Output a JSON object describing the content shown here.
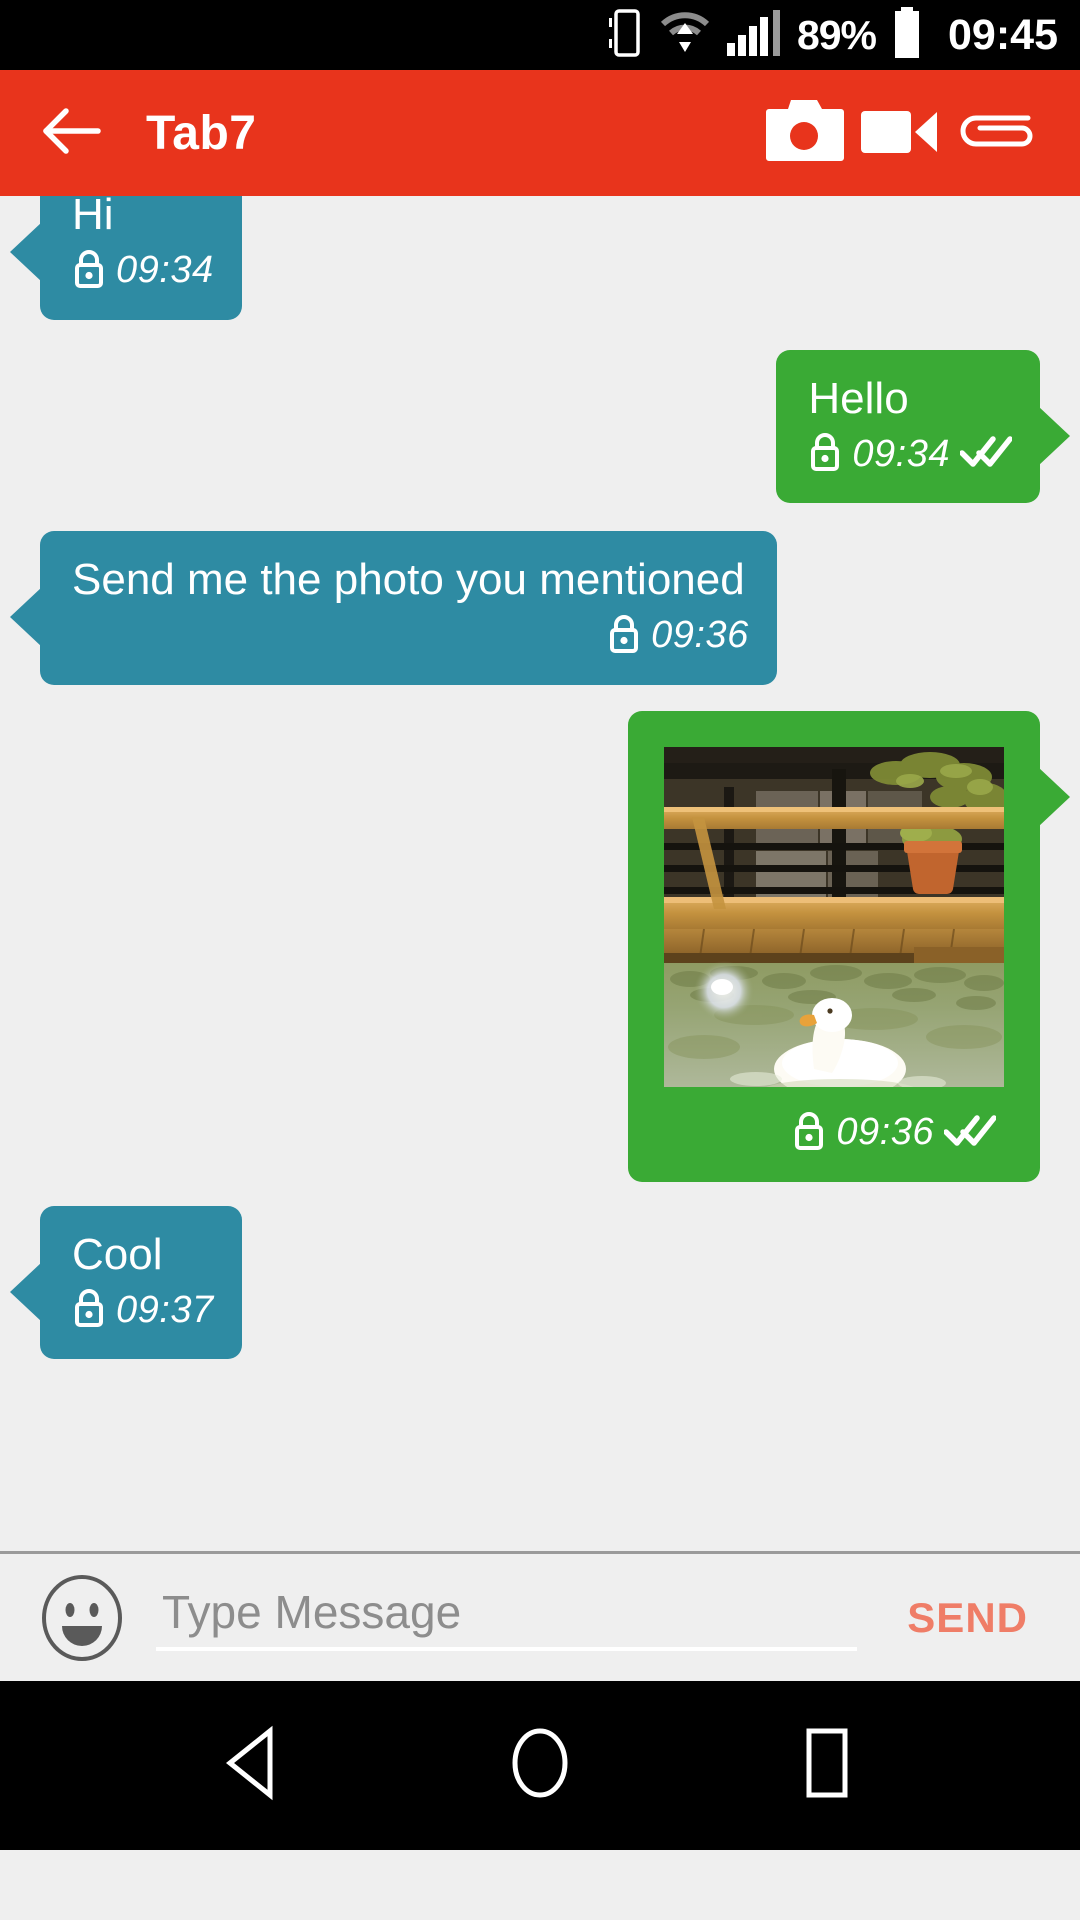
{
  "status_bar": {
    "vibrate_icon": "phone-vibrate-icon",
    "wifi_icon": "wifi-icon",
    "signal_icon": "cellular-signal-icon",
    "battery_percent": "89%",
    "battery_icon": "battery-icon",
    "clock": "09:45"
  },
  "app_bar": {
    "back_icon": "back-arrow-icon",
    "title": "Tab7",
    "actions": [
      {
        "icon": "camera-icon",
        "name": "camera-button"
      },
      {
        "icon": "video-camera-icon",
        "name": "video-button"
      },
      {
        "icon": "paperclip-icon",
        "name": "attach-button"
      }
    ],
    "background_color": "#e8341c"
  },
  "chat": {
    "incoming_bubble_color": "#2e8ba3",
    "outgoing_bubble_color": "#3aaa35",
    "background_color": "#efefef",
    "messages": [
      {
        "id": "msg-1",
        "direction": "incoming",
        "type": "text",
        "text": "Hi",
        "time": "09:34",
        "lock_icon": "lock-icon",
        "status_icon": ""
      },
      {
        "id": "msg-2",
        "direction": "outgoing",
        "type": "text",
        "text": "Hello",
        "time": "09:34",
        "lock_icon": "lock-icon",
        "status_icon": "double-check-icon"
      },
      {
        "id": "msg-3",
        "direction": "incoming",
        "type": "text",
        "text": "Send me the photo you mentioned",
        "time": "09:36",
        "lock_icon": "lock-icon",
        "status_icon": ""
      },
      {
        "id": "msg-4",
        "direction": "outgoing",
        "type": "image",
        "text": "",
        "image_description": "photo of a white duck swimming in green water below a wooden deck railing with a terracotta plant pot",
        "time": "09:36",
        "lock_icon": "lock-icon",
        "status_icon": "double-check-icon"
      },
      {
        "id": "msg-5",
        "direction": "incoming",
        "type": "text",
        "text": "Cool",
        "time": "09:37",
        "lock_icon": "lock-icon",
        "status_icon": ""
      }
    ]
  },
  "input_bar": {
    "emoji_icon": "smiley-face-icon",
    "message_value": "",
    "message_placeholder": "Type Message",
    "send_label": "SEND",
    "send_color": "#ef7d67"
  },
  "nav_bar": {
    "back_icon": "nav-back-triangle-icon",
    "home_icon": "nav-home-circle-icon",
    "recents_icon": "nav-recents-square-icon"
  }
}
